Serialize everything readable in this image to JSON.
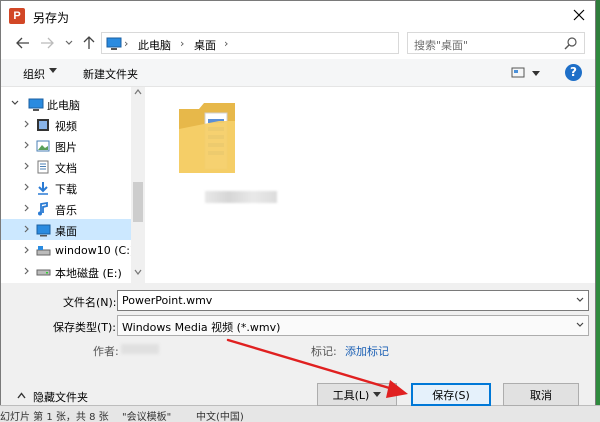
{
  "dialog": {
    "title": "另存为",
    "app_icon_letter": "P"
  },
  "address": {
    "crumbs": [
      "此电脑",
      "桌面"
    ],
    "separator": "›"
  },
  "search": {
    "placeholder": "搜索\"桌面\""
  },
  "toolbar": {
    "organize": "组织",
    "new_folder": "新建文件夹",
    "help": "?"
  },
  "nav": {
    "items": [
      {
        "label": "此电脑",
        "icon": "computer-icon",
        "expanded": true
      },
      {
        "label": "视频",
        "icon": "video-folder-icon"
      },
      {
        "label": "图片",
        "icon": "pictures-folder-icon"
      },
      {
        "label": "文档",
        "icon": "documents-folder-icon"
      },
      {
        "label": "下载",
        "icon": "download-folder-icon"
      },
      {
        "label": "音乐",
        "icon": "music-folder-icon"
      },
      {
        "label": "桌面",
        "icon": "desktop-folder-icon",
        "selected": true
      },
      {
        "label": "window10 (C:)",
        "icon": "system-drive-icon"
      },
      {
        "label": "本地磁盘 (E:)",
        "icon": "local-disk-icon"
      }
    ]
  },
  "form": {
    "filename_label": "文件名(N):",
    "filename_value": "PowerPoint.wmv",
    "type_label": "保存类型(T):",
    "type_value": "Windows Media 视频 (*.wmv)",
    "author_label": "作者:",
    "tags_label": "标记:",
    "tags_link": "添加标记",
    "hide_folders": "隐藏文件夹"
  },
  "buttons": {
    "tools": "工具(L)",
    "save": "保存(S)",
    "cancel": "取消"
  },
  "statusbar": {
    "left": "幻灯片 第 1 张，共 8 张",
    "middle": "\"会议模板\"",
    "right": "中文(中国)"
  },
  "colors": {
    "accent": "#0078d7",
    "selection": "#cce8ff",
    "annotation_arrow": "#e02020"
  }
}
